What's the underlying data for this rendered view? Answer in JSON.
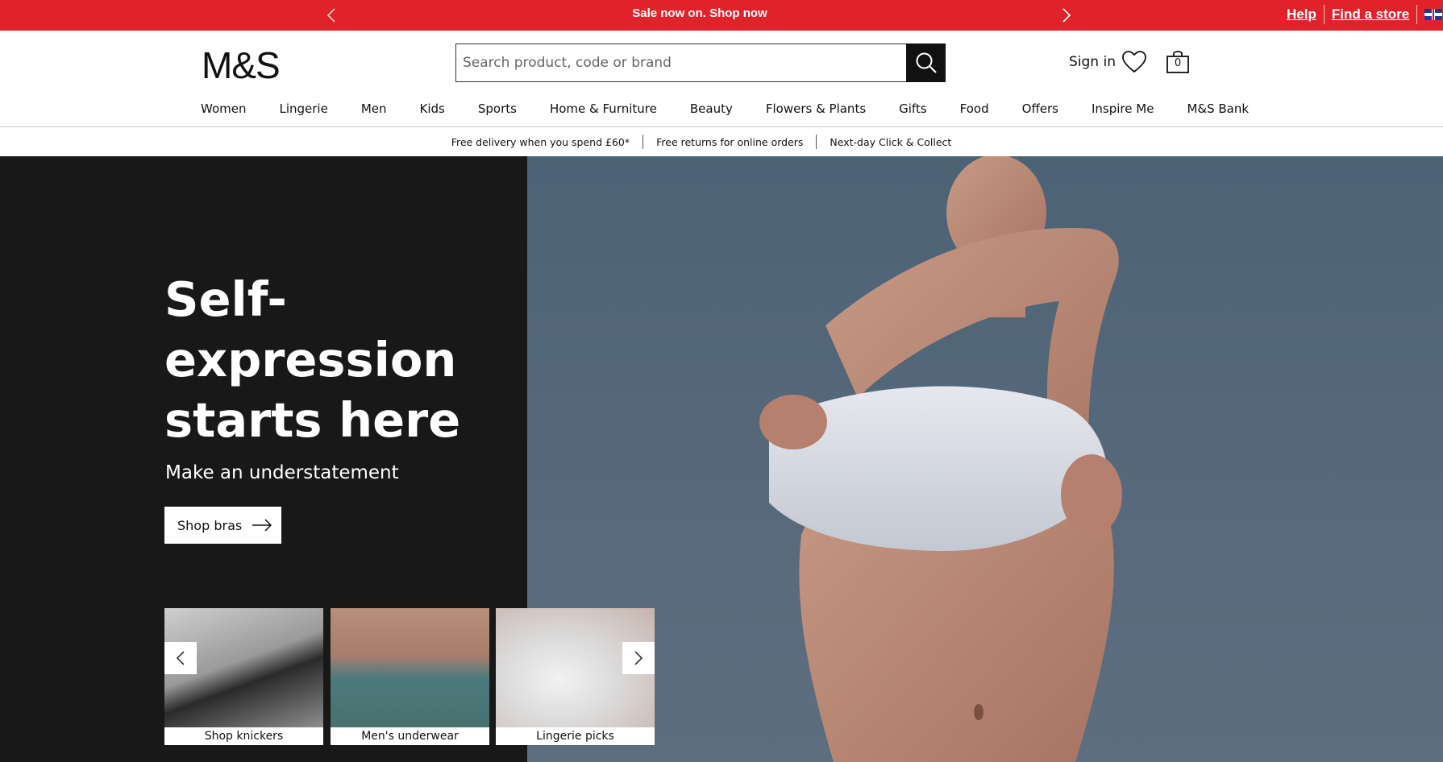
{
  "promo": {
    "message": "Sale now on. Shop now",
    "help": "Help",
    "find_store": "Find a store"
  },
  "header": {
    "logo": "M&S",
    "search_placeholder": "Search product, code or brand",
    "sign_in": "Sign in",
    "basket_count": "0"
  },
  "nav": {
    "items": [
      "Women",
      "Lingerie",
      "Men",
      "Kids",
      "Sports",
      "Home & Furniture",
      "Beauty",
      "Flowers & Plants",
      "Gifts",
      "Food",
      "Offers",
      "Inspire Me",
      "M&S Bank"
    ]
  },
  "benefits": [
    "Free delivery when you spend £60*",
    "Free returns for online orders",
    "Next-day Click & Collect"
  ],
  "hero": {
    "title": "Self-expression starts here",
    "subtitle": "Make an understatement",
    "cta": "Shop bras",
    "tiles": [
      {
        "label": "Shop knickers"
      },
      {
        "label": "Men's underwear"
      },
      {
        "label": "Lingerie picks"
      }
    ]
  },
  "colors": {
    "brand_red": "#e0232b",
    "hero_dark": "#181818"
  }
}
